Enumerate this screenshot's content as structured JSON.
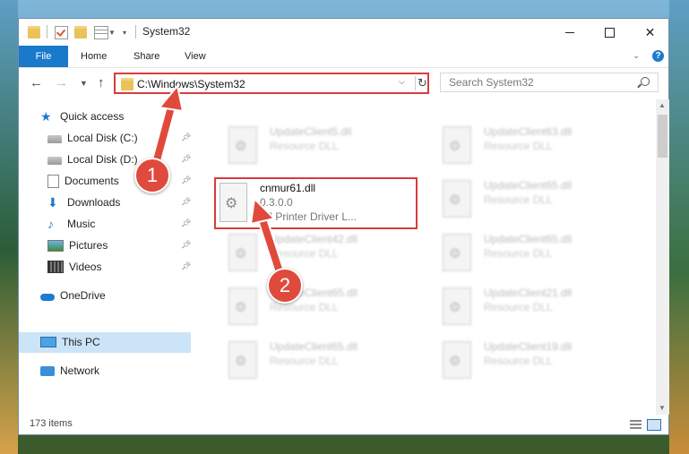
{
  "window": {
    "title": "System32",
    "controls": {
      "minimize": "minimize-icon",
      "maximize": "maximize-icon",
      "close": "close-icon"
    }
  },
  "ribbon": {
    "tabs": [
      "File",
      "Home",
      "Share",
      "View"
    ]
  },
  "address": {
    "path": "C:\\Windows\\System32",
    "search_placeholder": "Search System32"
  },
  "sidebar": {
    "items": [
      {
        "label": "Quick access",
        "icon": "star-icon"
      },
      {
        "label": "Local Disk (C:)",
        "icon": "disk-icon",
        "pinned": true
      },
      {
        "label": "Local Disk (D:)",
        "icon": "disk-icon",
        "pinned": true
      },
      {
        "label": "Documents",
        "icon": "documents-icon",
        "pinned": true
      },
      {
        "label": "Downloads",
        "icon": "downloads-icon",
        "pinned": true
      },
      {
        "label": "Music",
        "icon": "music-icon",
        "pinned": true
      },
      {
        "label": "Pictures",
        "icon": "pictures-icon",
        "pinned": true
      },
      {
        "label": "Videos",
        "icon": "videos-icon",
        "pinned": true
      },
      {
        "label": "OneDrive",
        "icon": "onedrive-icon"
      },
      {
        "label": "This PC",
        "icon": "pc-icon",
        "selected": true
      },
      {
        "label": "Network",
        "icon": "network-icon"
      }
    ]
  },
  "files": {
    "highlighted": {
      "name": "cnmur61.dll",
      "version": "0.3.0.0",
      "description": "BJ Printer Driver L..."
    },
    "left_column": [
      {
        "name": "UpdateClient5.dll",
        "description": "Resource DLL"
      },
      {
        "name": "UpdateClient42.dll",
        "description": "Resource DLL"
      },
      {
        "name": "UpdateClient65.dll",
        "description": "Resource DLL"
      },
      {
        "name": "UpdateClient65.dll",
        "description": "Resource DLL"
      }
    ],
    "right_column": [
      {
        "name": "UpdateClient63.dll",
        "description": "Resource DLL"
      },
      {
        "name": "UpdateClient65.dll",
        "description": "Resource DLL"
      },
      {
        "name": "UpdateClient65.dll",
        "description": "Resource DLL"
      },
      {
        "name": "UpdateClient21.dll",
        "description": "Resource DLL"
      },
      {
        "name": "UpdateClient19.dll",
        "description": "Resource DLL"
      }
    ]
  },
  "status": {
    "item_count": "173 items"
  },
  "callouts": [
    "1",
    "2"
  ],
  "colors": {
    "accent": "#1979ca",
    "highlight": "#d83c3c",
    "callout": "#e04a3c",
    "selection": "#cce4f7"
  }
}
